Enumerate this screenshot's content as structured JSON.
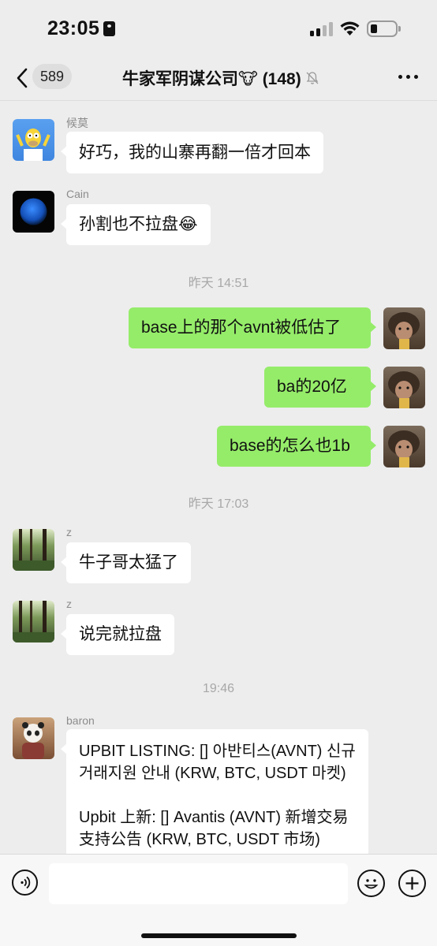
{
  "status_bar": {
    "time": "23:05"
  },
  "nav": {
    "back_count": "589",
    "title": "牛家军阴谋公司🐮 (148)"
  },
  "messages": [
    {
      "sender": "候莫",
      "text": "好巧，我的山寨再翻一倍才回本"
    },
    {
      "sender": "Cain",
      "text": "孙割也不拉盘😂"
    },
    {
      "timestamp": "昨天 14:51"
    },
    {
      "text": "base上的那个avnt被低估了"
    },
    {
      "text": "ba的20亿"
    },
    {
      "text": "base的怎么也1b"
    },
    {
      "timestamp": "昨天 17:03"
    },
    {
      "sender": "z",
      "text": "牛子哥太猛了"
    },
    {
      "sender": "z",
      "text": "说完就拉盘"
    },
    {
      "timestamp": "19:46"
    },
    {
      "sender": "baron",
      "text_p1": "UPBIT LISTING: [] 아반티스(AVNT) 신규 거래지원 안내 (KRW, BTC, USDT 마켓)",
      "text_p2": "Upbit 上新: [] Avantis (AVNT) 新增交易支持公告 (KRW, BTC, USDT 市场)"
    }
  ],
  "colors": {
    "background": "#ededed",
    "bubble_self": "#95ec69",
    "bubble_other": "#ffffff"
  }
}
